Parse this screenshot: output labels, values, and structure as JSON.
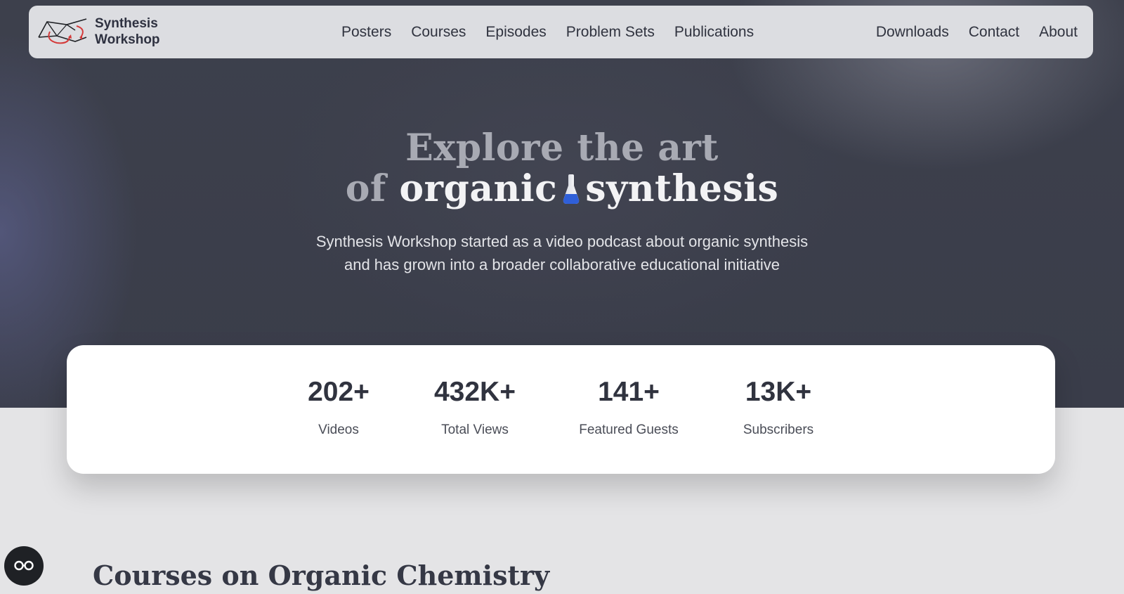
{
  "brand": {
    "line1": "Synthesis",
    "line2": "Workshop",
    "logo_icon": "molecule-logo-icon"
  },
  "nav": {
    "main": [
      "Posters",
      "Courses",
      "Episodes",
      "Problem Sets",
      "Publications"
    ],
    "right": [
      "Downloads",
      "Contact",
      "About"
    ]
  },
  "hero": {
    "line1": "Explore the art",
    "line2_muted": "of",
    "line2_word1": "organic",
    "line2_word2": "synthesis",
    "flask_icon": "flask-icon",
    "subtitle_line1": "Synthesis Workshop started as a video podcast about organic synthesis",
    "subtitle_line2": "and has grown into a broader collaborative educational initiative"
  },
  "stats": [
    {
      "value": "202+",
      "label": "Videos"
    },
    {
      "value": "432K+",
      "label": "Total Views"
    },
    {
      "value": "141+",
      "label": "Featured Guests"
    },
    {
      "value": "13K+",
      "label": "Subscribers"
    }
  ],
  "section": {
    "title": "Courses on Organic Chemistry"
  },
  "accessibility_button": {
    "icon": "glasses-icon"
  },
  "colors": {
    "hero_bg": "#3b3e4b",
    "nav_bg": "#dcdde1",
    "flask_liquid": "#2f5fd8",
    "logo_accent": "#d43a3a"
  }
}
